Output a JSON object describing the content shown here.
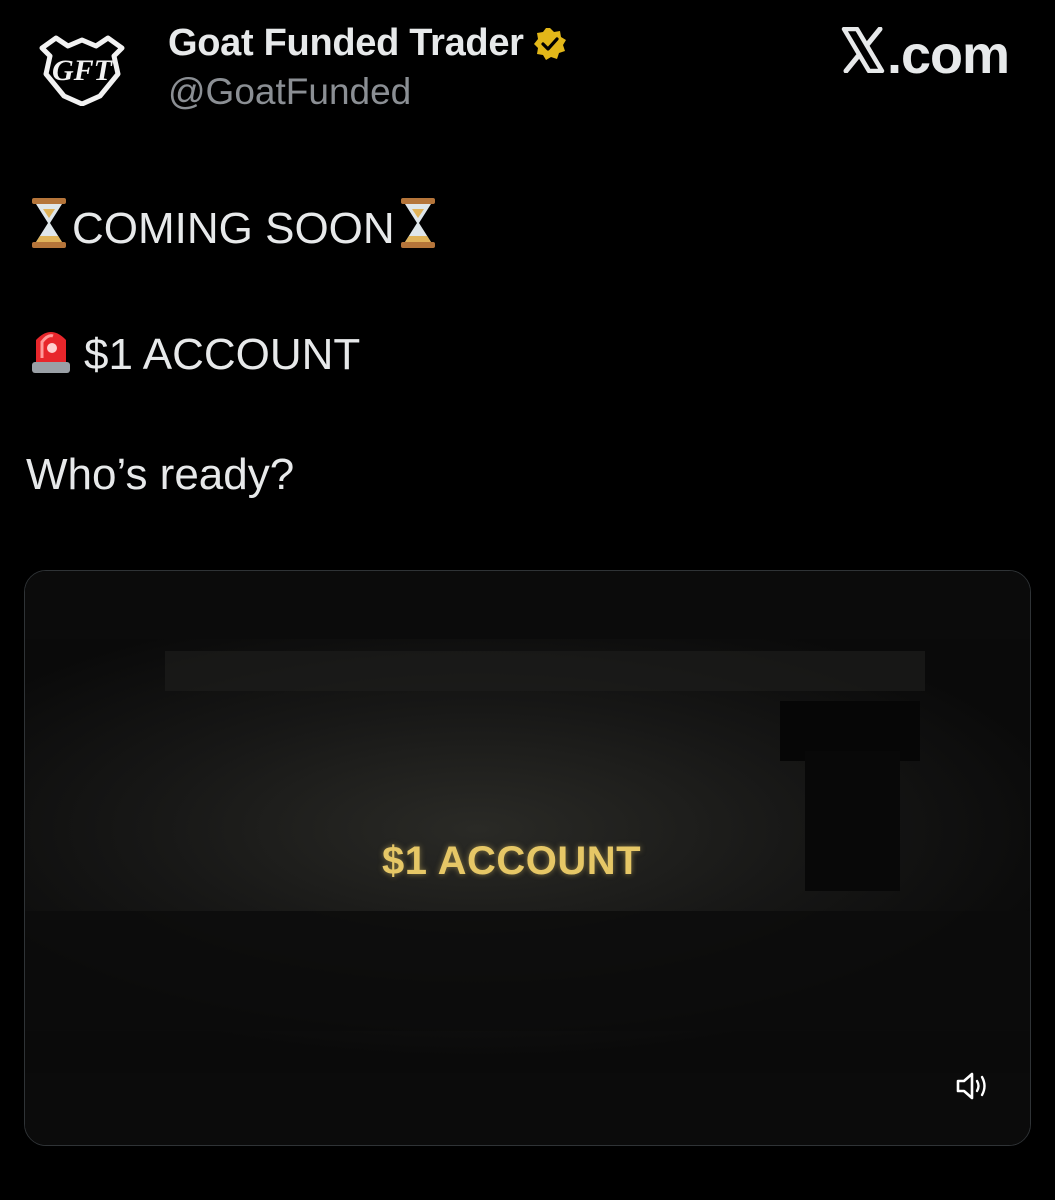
{
  "author": {
    "display_name": "Goat Funded Trader",
    "handle": "@GoatFunded",
    "avatar_icon": "gft-goat-logo",
    "verified_icon": "verified-badge-icon",
    "verified_color": "#e2b719"
  },
  "brand": {
    "text": ".com",
    "icon": "x-logo-icon"
  },
  "tweet": {
    "line1": {
      "emoji_left": "⏳",
      "text": "COMING SOON",
      "emoji_right": "⏳"
    },
    "line2": {
      "emoji": "🚨",
      "text": "$1 ACCOUNT"
    },
    "line3": {
      "text": "Who’s ready?"
    }
  },
  "media": {
    "type": "video",
    "caption": "$1 ACCOUNT",
    "caption_color": "#e6c766",
    "volume_icon": "speaker-icon"
  }
}
